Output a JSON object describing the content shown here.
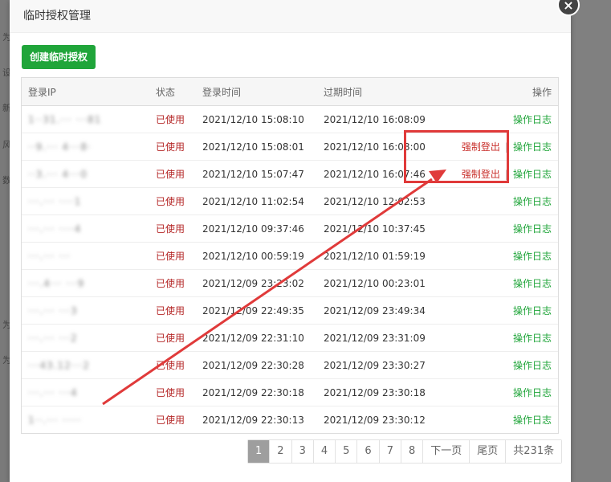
{
  "dialog": {
    "title": "临时授权管理",
    "close_label": "×",
    "create_button": "创建临时授权"
  },
  "table": {
    "headers": {
      "ip": "登录IP",
      "status": "状态",
      "login_time": "登录时间",
      "expire_time": "过期时间",
      "ops": "操作"
    },
    "rows": [
      {
        "ip": "1··31.··· ···81",
        "status": "已使用",
        "login": "2021/12/10 15:08:10",
        "expire": "2021/12/10 16:08:09",
        "force": "",
        "log": "操作日志"
      },
      {
        "ip": "··9.··· 4···8·",
        "status": "已使用",
        "login": "2021/12/10 15:08:01",
        "expire": "2021/12/10 16:08:00",
        "force": "强制登出",
        "log": "操作日志"
      },
      {
        "ip": "··3.··· 4···0",
        "status": "已使用",
        "login": "2021/12/10 15:07:47",
        "expire": "2021/12/10 16:07:46",
        "force": "强制登出",
        "log": "操作日志"
      },
      {
        "ip": "···.··· ····1",
        "status": "已使用",
        "login": "2021/12/10 11:02:54",
        "expire": "2021/12/10 12:02:53",
        "force": "",
        "log": "操作日志"
      },
      {
        "ip": "···.··· ····4",
        "status": "已使用",
        "login": "2021/12/10 09:37:46",
        "expire": "2021/12/10 10:37:45",
        "force": "",
        "log": "操作日志"
      },
      {
        "ip": "···.··· ···",
        "status": "已使用",
        "login": "2021/12/10 00:59:19",
        "expire": "2021/12/10 01:59:19",
        "force": "",
        "log": "操作日志"
      },
      {
        "ip": "···.4··· ···9",
        "status": "已使用",
        "login": "2021/12/09 23:23:02",
        "expire": "2021/12/10 00:23:01",
        "force": "",
        "log": "操作日志"
      },
      {
        "ip": "···.··· ···3",
        "status": "已使用",
        "login": "2021/12/09 22:49:35",
        "expire": "2021/12/09 23:49:34",
        "force": "",
        "log": "操作日志"
      },
      {
        "ip": "···.··· ···2",
        "status": "已使用",
        "login": "2021/12/09 22:31:10",
        "expire": "2021/12/09 23:31:09",
        "force": "",
        "log": "操作日志"
      },
      {
        "ip": "···43.12···2",
        "status": "已使用",
        "login": "2021/12/09 22:30:28",
        "expire": "2021/12/09 23:30:27",
        "force": "",
        "log": "操作日志"
      },
      {
        "ip": "···.··· ···4",
        "status": "已使用",
        "login": "2021/12/09 22:30:18",
        "expire": "2021/12/09 23:30:18",
        "force": "",
        "log": "操作日志"
      },
      {
        "ip": "1··.··· ·····",
        "status": "已使用",
        "login": "2021/12/09 22:30:13",
        "expire": "2021/12/09 23:30:12",
        "force": "",
        "log": "操作日志"
      }
    ]
  },
  "pagination": {
    "pages": [
      "1",
      "2",
      "3",
      "4",
      "5",
      "6",
      "7",
      "8"
    ],
    "current": "1",
    "next": "下一页",
    "last": "尾页",
    "total": "共231条"
  },
  "background_chars": [
    "为",
    "设",
    "新",
    "风",
    "数",
    "为",
    "为"
  ],
  "colors": {
    "accent_green": "#20a53a",
    "status_red": "#b52828",
    "annotation_red": "#e03a3a"
  }
}
